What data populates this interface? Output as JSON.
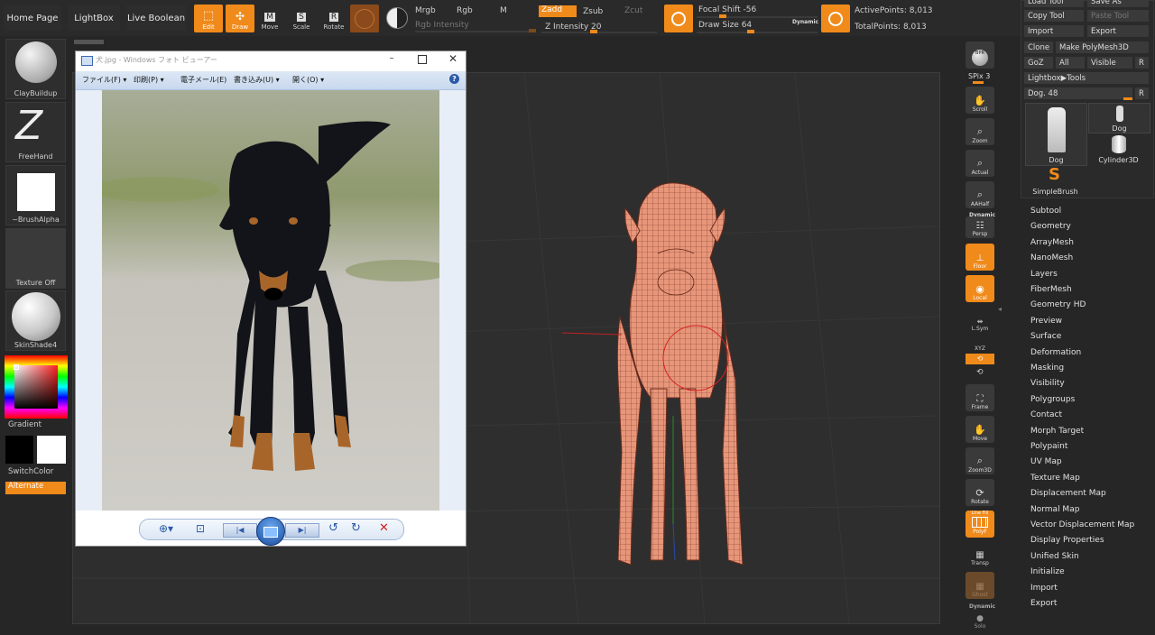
{
  "top": {
    "home_page": "Home Page",
    "lightbox": "LightBox",
    "live_boolean": "Live Boolean",
    "edit": "Edit",
    "draw": "Draw",
    "move": "Move",
    "scale": "Scale",
    "rotate": "Rotate",
    "mrgb": "Mrgb",
    "rgb": "Rgb",
    "m": "M",
    "rgb_intensity": "Rgb Intensity",
    "zadd": "Zadd",
    "zsub": "Zsub",
    "zcut": "Zcut",
    "z_intensity": "Z Intensity 20",
    "focal_shift": "Focal Shift -56",
    "draw_size": "Draw Size 64",
    "dynamic": "Dynamic",
    "active_points": "ActivePoints: 8,013",
    "total_points": "TotalPoints: 8,013",
    "accent": "#f08a1a"
  },
  "left": {
    "claybuildup": "ClayBuildup",
    "freehand": "FreeHand",
    "brushalpha": "~BrushAlpha",
    "texture_off": "Texture Off",
    "skinshade": "SkinShade4",
    "gradient": "Gradient",
    "switchcolor": "SwitchColor",
    "alternate": "Alternate"
  },
  "viewer": {
    "title": "犬.jpg - Windows フォト ビューアー",
    "menu_file": "ファイル(F)",
    "menu_print": "印刷(P)",
    "menu_email": "電子メール(E)",
    "menu_burn": "書き込み(U)",
    "menu_open": "開く(O)",
    "help": "?"
  },
  "right_tools": {
    "bpr": "BPR",
    "spix": "SPix 3",
    "scroll": "Scroll",
    "zoom": "Zoom",
    "actual": "Actual",
    "aahalf": "AAHalf",
    "dynamic": "Dynamic",
    "persp": "Persp",
    "floor": "Floor",
    "local": "Local",
    "lsym": "L.Sym",
    "xyz": "XYZ",
    "frame": "Frame",
    "move": "Move",
    "zoom3d": "Zoom3D",
    "rotate": "Rotate",
    "line_fill": "Line Fill",
    "polyf": "PolyF",
    "transp": "Transp",
    "ghost": "Ghost",
    "dynamic2": "Dynamic",
    "solo": "Solo"
  },
  "tool_panel": {
    "load_tool": "Load Tool",
    "save_as": "Save As",
    "copy_tool": "Copy Tool",
    "paste_tool": "Paste Tool",
    "import": "Import",
    "export": "Export",
    "clone": "Clone",
    "make_polymesh": "Make PolyMesh3D",
    "goz": "GoZ",
    "all": "All",
    "visible": "Visible",
    "r": "R",
    "lightbox_tools": "Lightbox▶Tools",
    "dog_slider": "Dog. 48",
    "r2": "R",
    "thumb_dog": "Dog",
    "thumb_dog_small": "Dog",
    "thumb_cylinder": "Cylinder3D",
    "thumb_simplebrush": "SimpleBrush"
  },
  "menu_items": [
    "Subtool",
    "Geometry",
    "ArrayMesh",
    "NanoMesh",
    "Layers",
    "FiberMesh",
    "Geometry HD",
    "Preview",
    "Surface",
    "Deformation",
    "Masking",
    "Visibility",
    "Polygroups",
    "Contact",
    "Morph Target",
    "Polypaint",
    "UV Map",
    "Texture Map",
    "Displacement Map",
    "Normal Map",
    "Vector Displacement Map",
    "Display Properties",
    "Unified Skin",
    "Initialize",
    "Import",
    "Export"
  ]
}
